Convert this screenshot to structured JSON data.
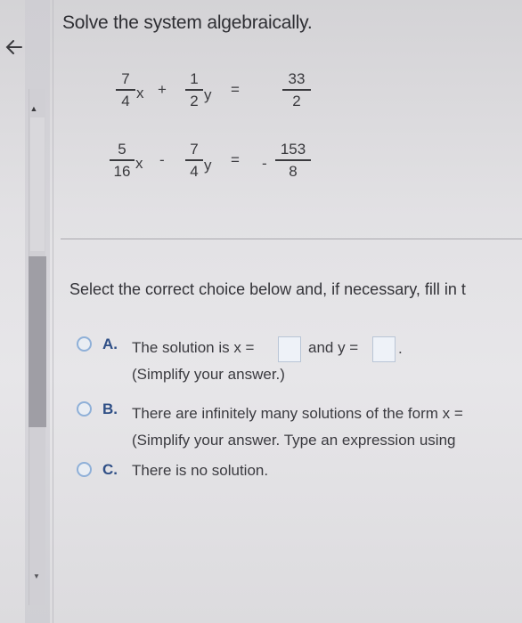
{
  "header": {
    "title": "Solve the system algebraically."
  },
  "equations": [
    {
      "a_num": "7",
      "a_den": "4",
      "var1": "x",
      "op": "+",
      "b_num": "1",
      "b_den": "2",
      "var2": "y",
      "eq": "=",
      "sign": "",
      "c_num": "33",
      "c_den": "2"
    },
    {
      "a_num": "5",
      "a_den": "16",
      "var1": "x",
      "op": "-",
      "b_num": "7",
      "b_den": "4",
      "var2": "y",
      "eq": "=",
      "sign": "-",
      "c_num": "153",
      "c_den": "8"
    }
  ],
  "question": {
    "prompt": "Select the correct choice below and, if necessary, fill in t"
  },
  "choices": [
    {
      "letter": "A.",
      "line1_pre": "The solution is x =",
      "line1_mid": "and y =",
      "line1_end": ".",
      "line2": "(Simplify your answer.)"
    },
    {
      "letter": "B.",
      "line1": "There are infinitely many solutions of the form x =",
      "line2": "(Simplify your answer. Type an expression using"
    },
    {
      "letter": "C.",
      "line1": "There is no solution."
    }
  ],
  "icons": {
    "back": "arrow-left-icon",
    "scroll_up": "triangle-up-icon",
    "scroll_down": "triangle-down-icon"
  }
}
